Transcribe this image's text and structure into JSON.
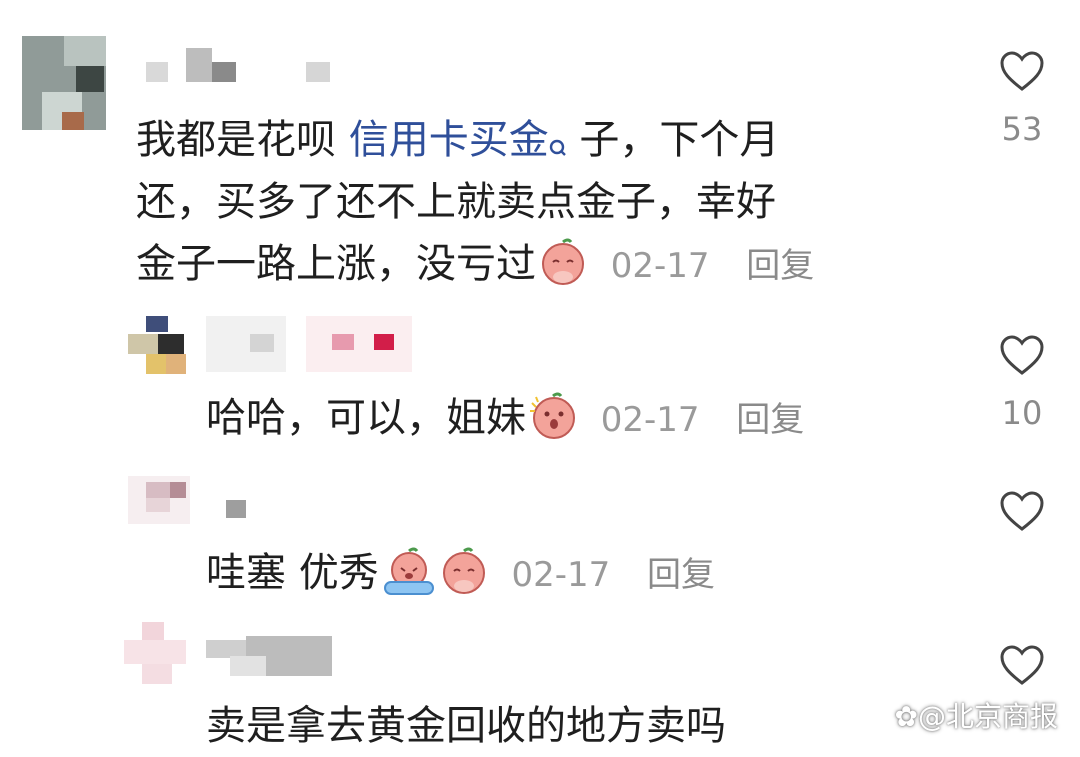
{
  "comments": [
    {
      "text_before_link": "我都是花呗 ",
      "link_text": "信用卡买金",
      "search_glyph": "search-icon",
      "line1_after": " 子，下个月",
      "line2": "还，买多了还不上就卖点金子，幸好",
      "line3": "金子一路上涨，没亏过",
      "date": "02-17",
      "reply_label": "回复",
      "likes": "53"
    },
    {
      "text": "哈哈，可以，姐妹",
      "date": "02-17",
      "reply_label": "回复",
      "likes": "10"
    },
    {
      "text": "哇塞 优秀",
      "date": "02-17",
      "reply_label": "回复"
    },
    {
      "text": "卖是拿去黄金回收的地方卖吗"
    }
  ],
  "watermark": "@北京商报",
  "colors": {
    "link": "#2f4f9a",
    "meta": "#9a9a9a",
    "text": "#1f1f1f"
  }
}
